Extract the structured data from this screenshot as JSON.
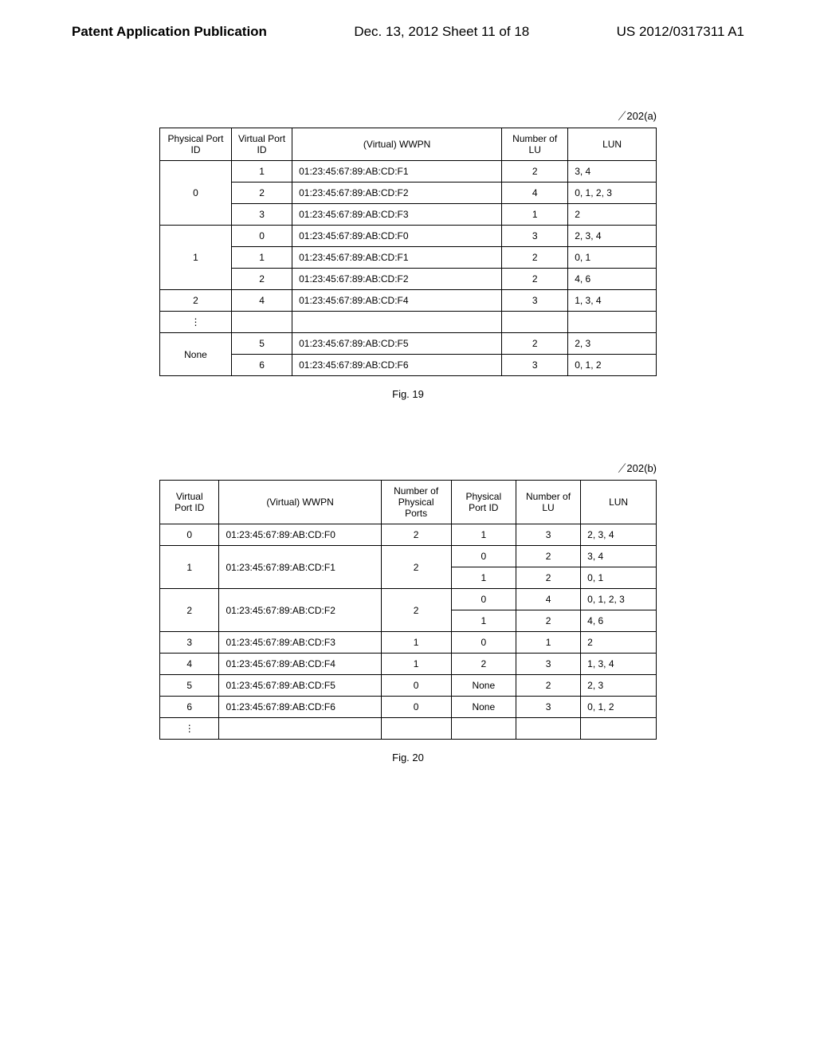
{
  "header": {
    "left": "Patent Application Publication",
    "center": "Dec. 13, 2012  Sheet 11 of 18",
    "right": "US 2012/0317311 A1"
  },
  "table_a": {
    "ref": "202(a)",
    "headers": {
      "physical_port_id": "Physical Port ID",
      "virtual_port_id": "Virtual Port ID",
      "wwpn": "(Virtual) WWPN",
      "number_of_lu": "Number of LU",
      "lun": "LUN"
    },
    "rows": [
      {
        "ppid": "0",
        "ppid_rowspan": 3,
        "vpid": "1",
        "wwpn": "01:23:45:67:89:AB:CD:F1",
        "nlu": "2",
        "lun": "3, 4"
      },
      {
        "vpid": "2",
        "wwpn": "01:23:45:67:89:AB:CD:F2",
        "nlu": "4",
        "lun": "0, 1, 2, 3"
      },
      {
        "vpid": "3",
        "wwpn": "01:23:45:67:89:AB:CD:F3",
        "nlu": "1",
        "lun": "2"
      },
      {
        "ppid": "1",
        "ppid_rowspan": 3,
        "vpid": "0",
        "wwpn": "01:23:45:67:89:AB:CD:F0",
        "nlu": "3",
        "lun": "2, 3, 4"
      },
      {
        "vpid": "1",
        "wwpn": "01:23:45:67:89:AB:CD:F1",
        "nlu": "2",
        "lun": "0, 1"
      },
      {
        "vpid": "2",
        "wwpn": "01:23:45:67:89:AB:CD:F2",
        "nlu": "2",
        "lun": "4, 6"
      },
      {
        "ppid": "2",
        "ppid_rowspan": 1,
        "vpid": "4",
        "wwpn": "01:23:45:67:89:AB:CD:F4",
        "nlu": "3",
        "lun": "1, 3, 4"
      },
      {
        "ppid": "⋮",
        "ppid_rowspan": 1,
        "vpid": "",
        "wwpn": "",
        "nlu": "",
        "lun": ""
      },
      {
        "ppid": "None",
        "ppid_rowspan": 2,
        "vpid": "5",
        "wwpn": "01:23:45:67:89:AB:CD:F5",
        "nlu": "2",
        "lun": "2, 3"
      },
      {
        "vpid": "6",
        "wwpn": "01:23:45:67:89:AB:CD:F6",
        "nlu": "3",
        "lun": "0, 1, 2"
      }
    ],
    "caption": "Fig. 19"
  },
  "table_b": {
    "ref": "202(b)",
    "headers": {
      "virtual_port_id": "Virtual Port ID",
      "wwpn": "(Virtual) WWPN",
      "number_physical_ports": "Number of Physical Ports",
      "physical_port_id": "Physical Port ID",
      "number_of_lu": "Number of LU",
      "lun": "LUN"
    },
    "rows": [
      {
        "vpid": "0",
        "vpid_rowspan": 1,
        "wwpn": "01:23:45:67:89:AB:CD:F0",
        "npp": "2",
        "ppid": "1",
        "nlu": "3",
        "lun": "2, 3, 4"
      },
      {
        "vpid": "1",
        "vpid_rowspan": 2,
        "wwpn": "01:23:45:67:89:AB:CD:F1",
        "npp": "2",
        "ppid": "0",
        "nlu": "2",
        "lun": "3, 4"
      },
      {
        "ppid": "1",
        "nlu": "2",
        "lun": "0, 1"
      },
      {
        "vpid": "2",
        "vpid_rowspan": 2,
        "wwpn": "01:23:45:67:89:AB:CD:F2",
        "npp": "2",
        "ppid": "0",
        "nlu": "4",
        "lun": "0, 1, 2, 3"
      },
      {
        "ppid": "1",
        "nlu": "2",
        "lun": "4, 6"
      },
      {
        "vpid": "3",
        "vpid_rowspan": 1,
        "wwpn": "01:23:45:67:89:AB:CD:F3",
        "npp": "1",
        "ppid": "0",
        "nlu": "1",
        "lun": "2"
      },
      {
        "vpid": "4",
        "vpid_rowspan": 1,
        "wwpn": "01:23:45:67:89:AB:CD:F4",
        "npp": "1",
        "ppid": "2",
        "nlu": "3",
        "lun": "1, 3, 4"
      },
      {
        "vpid": "5",
        "vpid_rowspan": 1,
        "wwpn": "01:23:45:67:89:AB:CD:F5",
        "npp": "0",
        "ppid": "None",
        "nlu": "2",
        "lun": "2, 3"
      },
      {
        "vpid": "6",
        "vpid_rowspan": 1,
        "wwpn": "01:23:45:67:89:AB:CD:F6",
        "npp": "0",
        "ppid": "None",
        "nlu": "3",
        "lun": "0, 1, 2"
      },
      {
        "vpid": "⋮",
        "vpid_rowspan": 1,
        "wwpn": "",
        "npp": "",
        "ppid": "",
        "nlu": "",
        "lun": ""
      }
    ],
    "caption": "Fig. 20"
  }
}
